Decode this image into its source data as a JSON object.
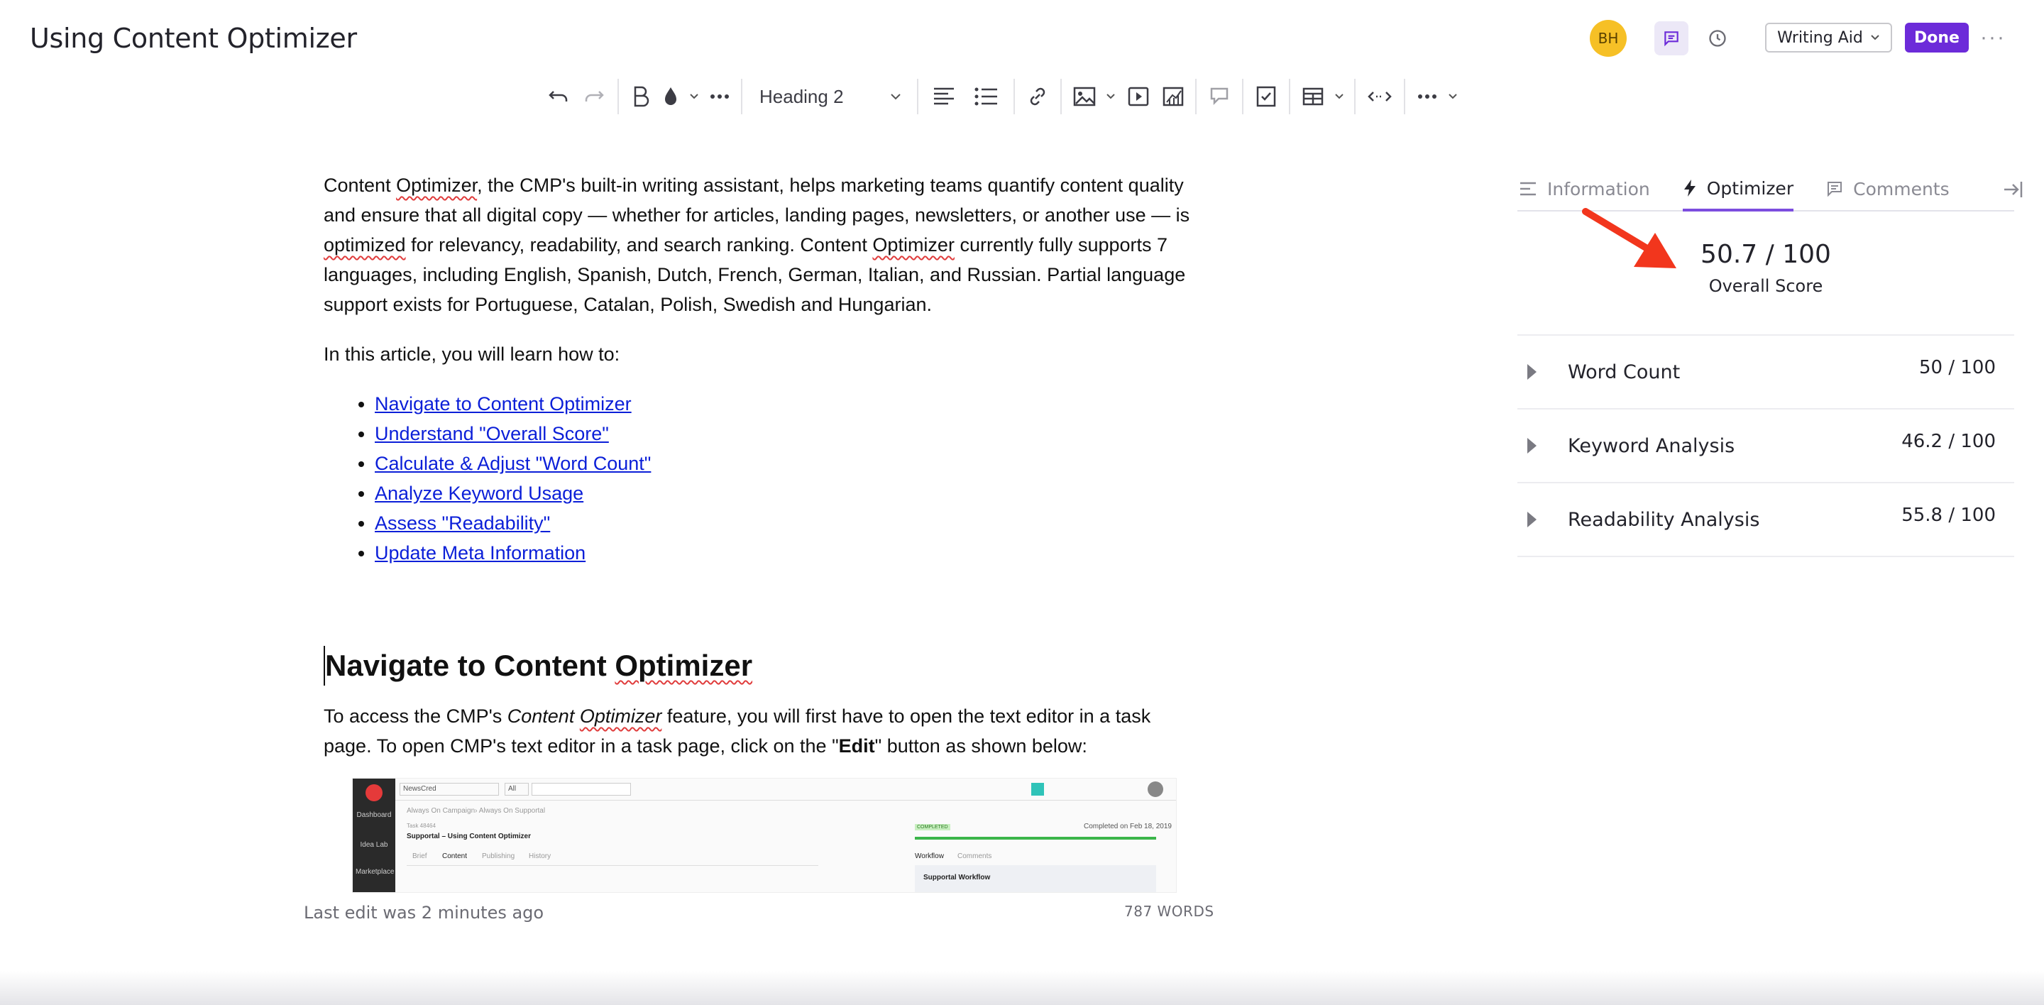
{
  "header": {
    "title": "Using Content Optimizer",
    "avatar_initials": "BH",
    "writing_aid_label": "Writing Aid",
    "done_label": "Done"
  },
  "toolbar": {
    "heading_select_value": "Heading 2"
  },
  "content": {
    "intro": {
      "p1_a": "Content ",
      "p1_b": "Optimizer",
      "p1_c": ", the CMP's built-in writing assistant, helps marketing teams quantify content quality and ensure that all digital copy — whether for articles, landing pages, newsletters, or another use — is ",
      "p1_d": "optimized",
      "p1_e": " for relevancy, readability, and search ranking. Content ",
      "p1_f": "Optimizer",
      "p1_g": " currently fully supports 7 languages, including English, Spanish, Dutch, French, German, Italian, and Russian. Partial language support exists for Portuguese, Catalan, Polish, Swedish and Hungarian."
    },
    "learn_intro": "In this article, you will learn how to:",
    "toc": [
      "Navigate to Content Optimizer",
      "Understand \"Overall Score\"",
      "Calculate & Adjust \"Word Count\"",
      "Analyze Keyword Usage",
      "Assess \"Readability\"",
      "Update Meta Information"
    ],
    "heading_a": "Navigate to Content ",
    "heading_b": "Optimizer",
    "para2_a": "To access the CMP's ",
    "para2_b_1": "Content ",
    "para2_b_2": "Optimizer",
    "para2_c": " feature, you will first have to open the text editor in a task page. To open CMP's text editor in a task page, click on the \"",
    "para2_bold": "Edit",
    "para2_d": "\" button as shown below:"
  },
  "embed": {
    "workspace": "NewsCred",
    "filter": "All",
    "breadcrumb": "Always On Campaign› Always On Supportal",
    "task_id": "Task 48464",
    "task_title": "Supportal – Using Content Optimizer",
    "tabs": [
      "Brief",
      "Content",
      "Publishing",
      "History"
    ],
    "status": "COMPLETED",
    "completed_text": "Completed on Feb 18, 2019",
    "wf_tabs": [
      "Workflow",
      "Comments"
    ],
    "workflow_name": "Supportal Workflow",
    "nav": [
      "Dashboard",
      "Idea Lab",
      "Marketplace"
    ]
  },
  "footer": {
    "last_edit": "Last edit was 2 minutes ago",
    "words": "787 WORDS"
  },
  "panel": {
    "tabs": [
      "Information",
      "Optimizer",
      "Comments"
    ],
    "overall_value": "50.7 / 100",
    "overall_label": "Overall Score",
    "metrics": [
      {
        "name": "Word Count",
        "value": "50 / 100"
      },
      {
        "name": "Keyword Analysis",
        "value": "46.2 / 100"
      },
      {
        "name": "Readability Analysis",
        "value": "55.8 / 100"
      }
    ]
  },
  "colors": {
    "accent": "#6c2bd9",
    "arrow": "#f2361d",
    "avatar": "#f6c026",
    "link": "#0b1fd8"
  }
}
